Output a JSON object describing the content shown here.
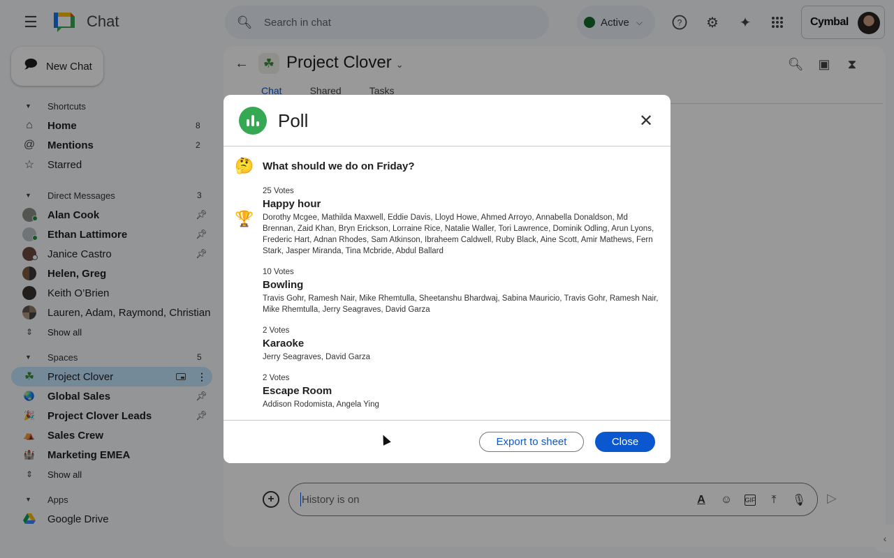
{
  "app": {
    "title": "Chat",
    "menu_icon": "hamburger-menu-icon",
    "logo_icon": "google-chat-logo"
  },
  "search": {
    "placeholder": "Search in chat",
    "icon": "search-icon"
  },
  "status": {
    "label": "Active",
    "color": "#146c2e"
  },
  "top_icons": [
    "help-icon",
    "settings-icon",
    "gemini-sparkle-icon",
    "apps-grid-icon"
  ],
  "account": {
    "brand": "Cymbal"
  },
  "sidebar": {
    "new_chat": "New Chat",
    "shortcuts": {
      "label": "Shortcuts",
      "items": [
        {
          "label": "Home",
          "count": "8",
          "icon": "home-icon",
          "bold": true
        },
        {
          "label": "Mentions",
          "count": "2",
          "icon": "at-sign-icon",
          "bold": true
        },
        {
          "label": "Starred",
          "count": "",
          "icon": "star-icon",
          "bold": false
        }
      ]
    },
    "direct_messages": {
      "label": "Direct Messages",
      "count": "3",
      "items": [
        {
          "label": "Alan Cook",
          "bold": true,
          "pinned": true,
          "presence": "online"
        },
        {
          "label": "Ethan Lattimore",
          "bold": true,
          "pinned": true,
          "presence": "online"
        },
        {
          "label": "Janice Castro",
          "bold": false,
          "pinned": true,
          "presence": "offline"
        },
        {
          "label": "Helen, Greg",
          "bold": true,
          "pinned": false
        },
        {
          "label": "Keith O’Brien",
          "bold": false,
          "pinned": false
        },
        {
          "label": "Lauren, Adam, Raymond, Christian",
          "bold": false,
          "pinned": false
        }
      ],
      "show_all": "Show all"
    },
    "spaces": {
      "label": "Spaces",
      "count": "5",
      "items": [
        {
          "label": "Project Clover",
          "bold": false,
          "selected": true,
          "icon": "☘"
        },
        {
          "label": "Global Sales",
          "bold": true,
          "pinned": true,
          "icon": "🌏"
        },
        {
          "label": "Project Clover Leads",
          "bold": true,
          "pinned": true,
          "icon": "🎉"
        },
        {
          "label": "Sales Crew",
          "bold": true,
          "icon": "⛺"
        },
        {
          "label": "Marketing EMEA",
          "bold": true,
          "icon": "🏰"
        }
      ],
      "show_all": "Show all"
    },
    "apps": {
      "label": "Apps",
      "items": [
        {
          "label": "Google Drive",
          "icon": "google-drive-icon"
        }
      ]
    }
  },
  "space": {
    "title": "Project Clover",
    "icon": "☘",
    "tabs": [
      {
        "label": "Chat",
        "active": true
      },
      {
        "label": "Shared",
        "active": false
      },
      {
        "label": "Tasks",
        "active": false
      }
    ],
    "header_icons": [
      "search-icon",
      "picture-in-picture-icon",
      "history-hourglass-icon"
    ]
  },
  "composer": {
    "placeholder": "History is on",
    "tools": [
      "format-text-icon",
      "emoji-icon",
      "gif-icon",
      "upload-icon",
      "microphone-icon"
    ]
  },
  "modal": {
    "title": "Poll",
    "question_emoji": "🤔",
    "question": "What should we do on Friday?",
    "winner_icon": "🏆",
    "options": [
      {
        "votes": "25 Votes",
        "name": "Happy hour",
        "voters": "Dorothy Mcgee, Mathilda Maxwell, Eddie Davis, Lloyd Howe, Ahmed Arroyo, Annabella Donaldson, Md Brennan, Zaid Khan, Bryn Erickson, Lorraine Rice, Natalie Waller, Tori Lawrence, Dominik Odling, Arun Lyons, Frederic Hart, Adnan Rhodes, Sam Atkinson, Ibraheem Caldwell, Ruby Black, Aine Scott, Amir Mathews, Fern Stark, Jasper Miranda, Tina Mcbride, Abdul Ballard"
      },
      {
        "votes": "10 Votes",
        "name": "Bowling",
        "voters": "Travis Gohr, Ramesh Nair, Mike Rhemtulla, Sheetanshu Bhardwaj, Sabina Mauricio, Travis Gohr, Ramesh Nair, Mike Rhemtulla, Jerry Seagraves, David Garza"
      },
      {
        "votes": "2 Votes",
        "name": "Karaoke",
        "voters": "Jerry Seagraves, David Garza"
      },
      {
        "votes": "2 Votes",
        "name": "Escape Room",
        "voters": "Addison Rodomista, Angela Ying"
      }
    ],
    "export_label": "Export to sheet",
    "close_label": "Close",
    "accent": "#0b57d0",
    "poll_icon_color": "#34a853"
  }
}
